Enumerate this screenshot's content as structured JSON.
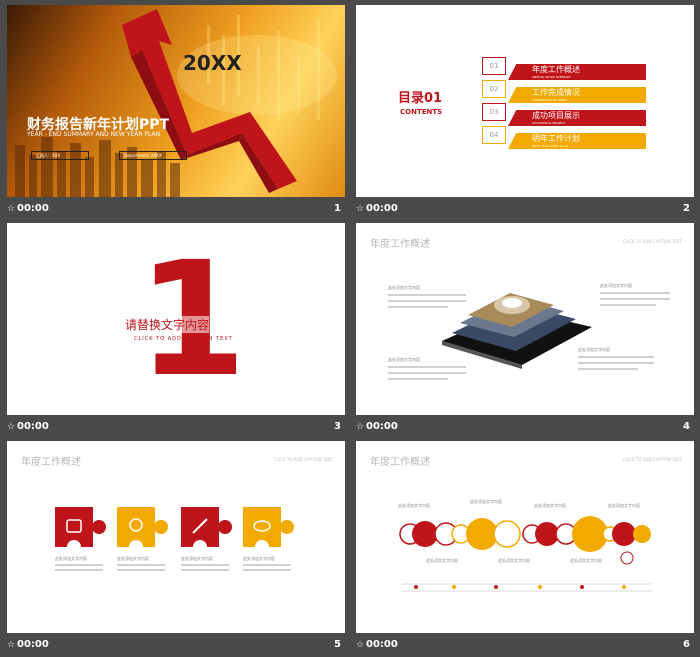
{
  "colors": {
    "red": "#c0141b",
    "yellow": "#f2a900",
    "dark": "#4a4a4a"
  },
  "slides": [
    {
      "number": "1",
      "time": "00:00",
      "title_zh": "财务报告新年计划PPT",
      "subtitle": "YEAR - END SUMMARY AND NEW YEAR PLAN",
      "year": "20XX",
      "name_label": "汇报人：XXX",
      "dept_label": "Department: XXXX"
    },
    {
      "number": "2",
      "time": "00:00",
      "toc_title": "目录01",
      "toc_sub": "CONTENTS",
      "items": [
        {
          "num": "01",
          "label": "年度工作概述",
          "sub": "ANNUAL WORK SUMMARY"
        },
        {
          "num": "02",
          "label": "工作完成情况",
          "sub": "COMPLETION OF WORK"
        },
        {
          "num": "03",
          "label": "成功项目展示",
          "sub": "SUCCESSFUL PROJECT"
        },
        {
          "num": "04",
          "label": "明年工作计划",
          "sub": "NEXT YEAR WORK PLAN"
        }
      ]
    },
    {
      "number": "3",
      "time": "00:00",
      "big": "1",
      "heading": "请替换文字内容",
      "caption": "CLICK TO ADD CAPTION TEXT"
    },
    {
      "number": "4",
      "time": "00:00",
      "title": "年度工作概述",
      "cap": "CLICK TO ADD CAPTION TEXT",
      "point_label": "此处添加文字内容"
    },
    {
      "number": "5",
      "time": "00:00",
      "title": "年度工作概述",
      "cap": "CLICK TO ADD CAPTION TEXT",
      "puzzle_label": "此处添加文字内容"
    },
    {
      "number": "6",
      "time": "00:00",
      "title": "年度工作概述",
      "cap": "CLICK TO ADD CAPTION TEXT",
      "node_label": "此处添加文字内容"
    }
  ]
}
